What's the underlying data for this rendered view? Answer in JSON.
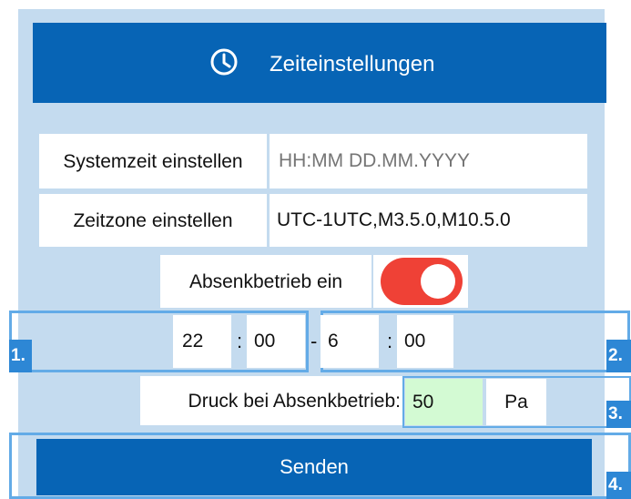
{
  "header": {
    "title": "Zeiteinstellungen",
    "icon": "clock-icon"
  },
  "system_time": {
    "label": "Systemzeit einstellen",
    "placeholder": "HH:MM DD.MM.YYYY"
  },
  "timezone": {
    "label": "Zeitzone einstellen",
    "value": "UTC-1UTC,M3.5.0,M10.5.0"
  },
  "setback": {
    "label": "Absenkbetrieb ein",
    "enabled": true
  },
  "time_range": {
    "start": {
      "hour": "22",
      "minute": "00"
    },
    "separator_time": ":",
    "range_separator": "-",
    "end": {
      "hour": "6",
      "minute": "00"
    }
  },
  "pressure": {
    "label": "Druck bei Absenkbetrieb:",
    "value": "50",
    "unit": "Pa"
  },
  "send_button": {
    "label": "Senden"
  },
  "markers": [
    "1.",
    "2.",
    "3.",
    "4."
  ],
  "colors": {
    "primary": "#0764b5",
    "panel_bg": "#c4dbef",
    "toggle_on": "#ef4136",
    "highlight_frame": "#63abe7",
    "marker_bg": "#2d87d5",
    "pressure_field_bg": "#d3fad3"
  }
}
